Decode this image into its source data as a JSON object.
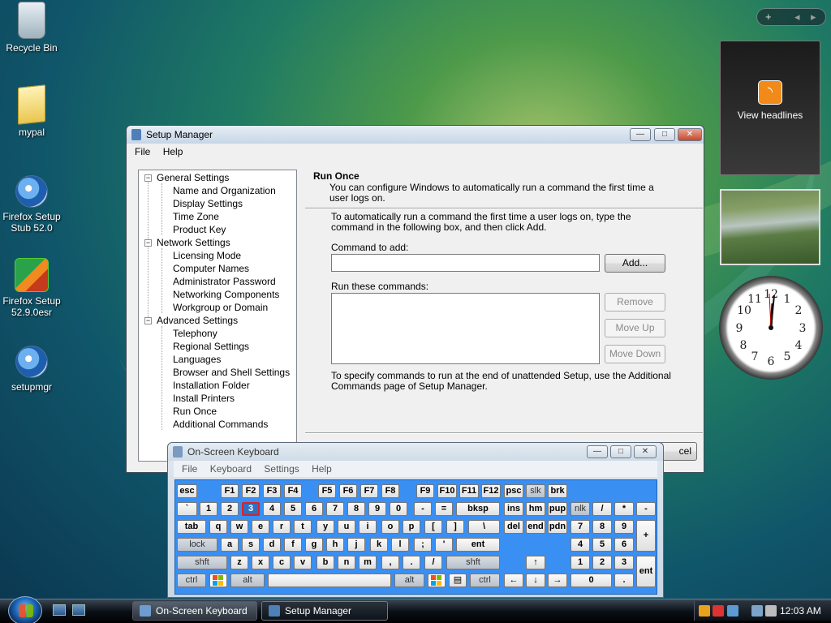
{
  "desktop": {
    "icons": [
      {
        "label": "Recycle Bin"
      },
      {
        "label": "mypal"
      },
      {
        "label": "Firefox Setup Stub 52.0"
      },
      {
        "label": "Firefox Setup 52.9.0esr"
      },
      {
        "label": "setupmgr"
      }
    ],
    "gadgets": {
      "rss_label": "View headlines",
      "rss_glyph": "◝",
      "sidebar_add": "+",
      "sidebar_prev": "◂",
      "sidebar_next": "▸"
    }
  },
  "setup_manager": {
    "title": "Setup Manager",
    "menu": [
      "File",
      "Help"
    ],
    "tree": [
      {
        "label": "General Settings",
        "level": 0
      },
      {
        "label": "Name and Organization",
        "level": 1
      },
      {
        "label": "Display Settings",
        "level": 1
      },
      {
        "label": "Time Zone",
        "level": 1
      },
      {
        "label": "Product Key",
        "level": 1
      },
      {
        "label": "Network Settings",
        "level": 0
      },
      {
        "label": "Licensing Mode",
        "level": 1
      },
      {
        "label": "Computer Names",
        "level": 1
      },
      {
        "label": "Administrator Password",
        "level": 1
      },
      {
        "label": "Networking Components",
        "level": 1
      },
      {
        "label": "Workgroup or Domain",
        "level": 1
      },
      {
        "label": "Advanced Settings",
        "level": 0
      },
      {
        "label": "Telephony",
        "level": 1
      },
      {
        "label": "Regional Settings",
        "level": 1
      },
      {
        "label": "Languages",
        "level": 1
      },
      {
        "label": "Browser and Shell Settings",
        "level": 1
      },
      {
        "label": "Installation Folder",
        "level": 1
      },
      {
        "label": "Install Printers",
        "level": 1
      },
      {
        "label": "Run Once",
        "level": 1
      },
      {
        "label": "Additional Commands",
        "level": 1
      }
    ],
    "page": {
      "title": "Run Once",
      "description": "You can configure Windows to automatically run a command the first time a user logs on.",
      "instructions": "To automatically run a command the first time a user logs on, type the command in the following box, and then click Add.",
      "command_label": "Command to add:",
      "command_value": "",
      "add_button": "Add...",
      "list_label": "Run these commands:",
      "remove_button": "Remove",
      "move_up_button": "Move Up",
      "move_down_button": "Move Down",
      "footer": "To specify commands to run at the end of unattended Setup, use the Additional Commands page of Setup Manager.",
      "cancel_fragment": "cel"
    }
  },
  "osk": {
    "title": "On-Screen Keyboard",
    "menu": [
      "File",
      "Keyboard",
      "Settings",
      "Help"
    ],
    "pressed_key": "3",
    "rows": {
      "r1": [
        "esc",
        "F1",
        "F2",
        "F3",
        "F4",
        "F5",
        "F6",
        "F7",
        "F8",
        "F9",
        "F10",
        "F11",
        "F12",
        "psc",
        "slk",
        "brk"
      ],
      "r2": [
        "`",
        "1",
        "2",
        "3",
        "4",
        "5",
        "6",
        "7",
        "8",
        "9",
        "0",
        "-",
        "=",
        "bksp",
        "ins",
        "hm",
        "pup",
        "nlk",
        "/",
        "*",
        "-"
      ],
      "r3": [
        "tab",
        "q",
        "w",
        "e",
        "r",
        "t",
        "y",
        "u",
        "i",
        "o",
        "p",
        "[",
        "]",
        "\\",
        "del",
        "end",
        "pdn",
        "7",
        "8",
        "9",
        "+"
      ],
      "r4": [
        "lock",
        "a",
        "s",
        "d",
        "f",
        "g",
        "h",
        "j",
        "k",
        "l",
        ";",
        "'",
        "ent",
        "↑",
        "4",
        "5",
        "6"
      ],
      "r5": [
        "shft",
        "z",
        "x",
        "c",
        "v",
        "b",
        "n",
        "m",
        ",",
        ".",
        "/",
        "shft",
        "1",
        "2",
        "3",
        "ent"
      ],
      "r6": [
        "ctrl",
        "alt",
        "alt",
        "ctrl",
        "←",
        "↓",
        "→",
        "0",
        "."
      ]
    }
  },
  "taskbar": {
    "tasks": [
      "On-Screen Keyboard",
      "Setup Manager"
    ],
    "clock": "12:03 AM"
  }
}
